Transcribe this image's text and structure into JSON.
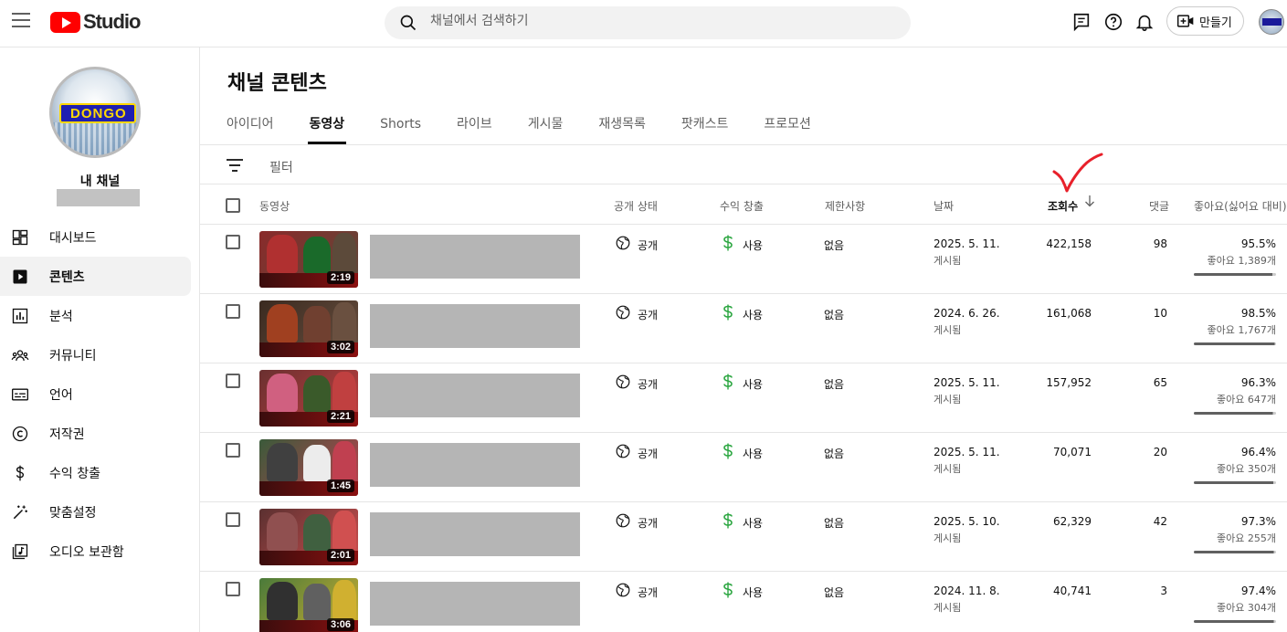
{
  "app": {
    "logo_text": "Studio",
    "search_placeholder": "채널에서 검색하기",
    "create_label": "만들기"
  },
  "sidebar": {
    "channel_label": "내 채널",
    "avatar_text": "DONGO",
    "items": [
      {
        "label": "대시보드",
        "icon": "dashboard-icon"
      },
      {
        "label": "콘텐츠",
        "icon": "content-icon",
        "active": true
      },
      {
        "label": "분석",
        "icon": "analytics-icon"
      },
      {
        "label": "커뮤니티",
        "icon": "community-icon"
      },
      {
        "label": "언어",
        "icon": "subtitles-icon"
      },
      {
        "label": "저작권",
        "icon": "copyright-icon"
      },
      {
        "label": "수익 창출",
        "icon": "dollar-icon"
      },
      {
        "label": "맞춤설정",
        "icon": "magic-wand-icon"
      },
      {
        "label": "오디오 보관함",
        "icon": "audio-library-icon"
      }
    ]
  },
  "main": {
    "title": "채널 콘텐츠",
    "tabs": [
      "아이디어",
      "동영상",
      "Shorts",
      "라이브",
      "게시물",
      "재생목록",
      "팟캐스트",
      "프로모션"
    ],
    "active_tab": "동영상",
    "filter_label": "필터",
    "columns": {
      "video": "동영상",
      "visibility": "공개 상태",
      "monetization": "수익 창출",
      "restrictions": "제한사항",
      "date": "날짜",
      "views": "조회수",
      "comments": "댓글",
      "likes": "좋아요(싫어요 대비)"
    },
    "rows": [
      {
        "duration": "2:19",
        "visibility": "공개",
        "monetization": "사용",
        "restrictions": "없음",
        "date": "2025. 5. 11.",
        "date_status": "게시됨",
        "views": "422,158",
        "comments": "98",
        "like_pct": "95.5%",
        "like_count": "좋아요 1,389개",
        "like_ratio": 0.955
      },
      {
        "duration": "3:02",
        "visibility": "공개",
        "monetization": "사용",
        "restrictions": "없음",
        "date": "2024. 6. 26.",
        "date_status": "게시됨",
        "views": "161,068",
        "comments": "10",
        "like_pct": "98.5%",
        "like_count": "좋아요 1,767개",
        "like_ratio": 0.985
      },
      {
        "duration": "2:21",
        "visibility": "공개",
        "monetization": "사용",
        "restrictions": "없음",
        "date": "2025. 5. 11.",
        "date_status": "게시됨",
        "views": "157,952",
        "comments": "65",
        "like_pct": "96.3%",
        "like_count": "좋아요 647개",
        "like_ratio": 0.963
      },
      {
        "duration": "1:45",
        "visibility": "공개",
        "monetization": "사용",
        "restrictions": "없음",
        "date": "2025. 5. 11.",
        "date_status": "게시됨",
        "views": "70,071",
        "comments": "20",
        "like_pct": "96.4%",
        "like_count": "좋아요 350개",
        "like_ratio": 0.964
      },
      {
        "duration": "2:01",
        "visibility": "공개",
        "monetization": "사용",
        "restrictions": "없음",
        "date": "2025. 5. 10.",
        "date_status": "게시됨",
        "views": "62,329",
        "comments": "42",
        "like_pct": "97.3%",
        "like_count": "좋아요 255개",
        "like_ratio": 0.973
      },
      {
        "duration": "3:06",
        "visibility": "공개",
        "monetization": "사용",
        "restrictions": "없음",
        "date": "2024. 11. 8.",
        "date_status": "게시됨",
        "views": "40,741",
        "comments": "3",
        "like_pct": "97.4%",
        "like_count": "좋아요 304개",
        "like_ratio": 0.974
      }
    ]
  },
  "colors": {
    "brand_red": "#ff0000",
    "monetization_green": "#2ba640",
    "annotation_red": "#e8202a"
  }
}
